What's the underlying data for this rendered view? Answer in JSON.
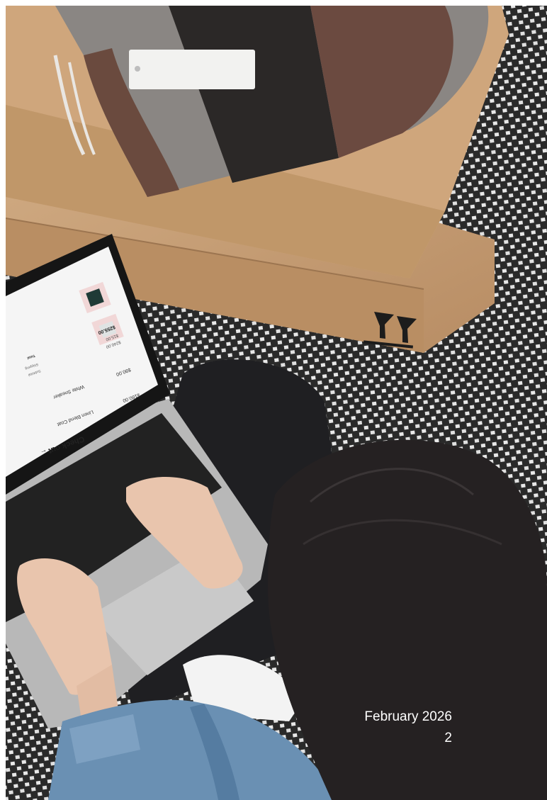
{
  "footer": {
    "date": "February 2026",
    "page": "2"
  },
  "screen": {
    "title": "Check out",
    "item1_name": "Linen Blend Coat",
    "item1_price": "$180.00",
    "item2_name": "White Sneaker",
    "item2_price": "$90.00",
    "subtotal_label": "Subtotal",
    "subtotal_value": "$240.00",
    "shipping_label": "Shipping",
    "shipping_value": "$15.00",
    "total_label": "Total",
    "total_value": "$255.00"
  },
  "colors": {
    "cardboard": "#c39a70",
    "carpet_dark": "#2a2a2a",
    "carpet_light": "#e6e6e6",
    "denim": "#5e87ad",
    "hair": "#262223",
    "skin": "#e8c3ab",
    "laptop": "#b5b5b5"
  },
  "icons": [
    "arrow-back-icon",
    "up-arrows-symbol"
  ]
}
